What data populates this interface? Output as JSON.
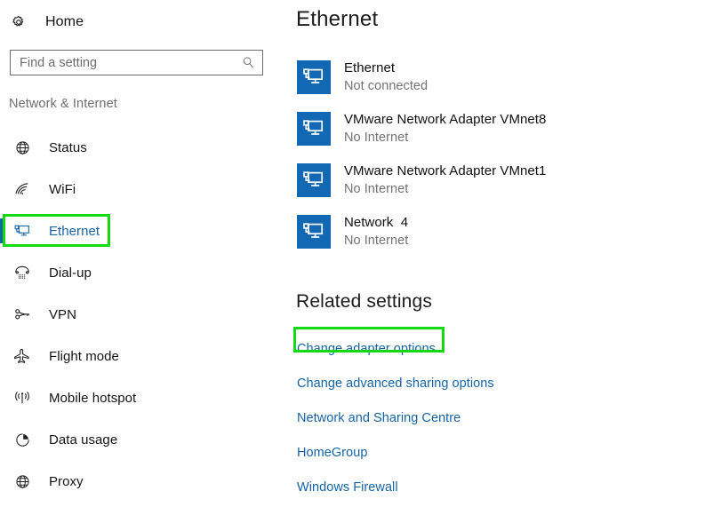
{
  "window": {
    "title": "Settings",
    "accent_color": "#1664a8",
    "highlight_color": "#16d916",
    "adapter_icon_color": "#1268b3"
  },
  "sidebar": {
    "home_label": "Home",
    "home_icon": "gear-icon",
    "search": {
      "placeholder": "Find a setting",
      "value": "",
      "icon": "search-icon"
    },
    "section_header": "Network & Internet",
    "items": [
      {
        "label": "Status",
        "icon": "globe-icon",
        "selected": false
      },
      {
        "label": "WiFi",
        "icon": "wifi-icon",
        "selected": false
      },
      {
        "label": "Ethernet",
        "icon": "ethernet-icon",
        "selected": true
      },
      {
        "label": "Dial-up",
        "icon": "phone-handset-icon",
        "selected": false
      },
      {
        "label": "VPN",
        "icon": "vpn-key-icon",
        "selected": false
      },
      {
        "label": "Flight mode",
        "icon": "airplane-icon",
        "selected": false
      },
      {
        "label": "Mobile hotspot",
        "icon": "broadcast-icon",
        "selected": false
      },
      {
        "label": "Data usage",
        "icon": "pie-chart-icon",
        "selected": false
      },
      {
        "label": "Proxy",
        "icon": "globe-icon",
        "selected": false
      }
    ]
  },
  "main": {
    "page_title": "Ethernet",
    "adapters": [
      {
        "name": "Ethernet",
        "status": "Not connected",
        "icon": "ethernet-adapter-icon"
      },
      {
        "name": "VMware Network Adapter VMnet8",
        "status": "No Internet",
        "icon": "ethernet-adapter-icon"
      },
      {
        "name": "VMware Network Adapter VMnet1",
        "status": "No Internet",
        "icon": "ethernet-adapter-icon"
      },
      {
        "name": "Network  4",
        "status": "No Internet",
        "icon": "ethernet-adapter-icon"
      }
    ],
    "related_settings": {
      "title": "Related settings",
      "links": [
        {
          "label": "Change adapter options",
          "highlighted": true
        },
        {
          "label": "Change advanced sharing options",
          "highlighted": false
        },
        {
          "label": "Network and Sharing Centre",
          "highlighted": false
        },
        {
          "label": "HomeGroup",
          "highlighted": false
        },
        {
          "label": "Windows Firewall",
          "highlighted": false
        }
      ]
    }
  }
}
